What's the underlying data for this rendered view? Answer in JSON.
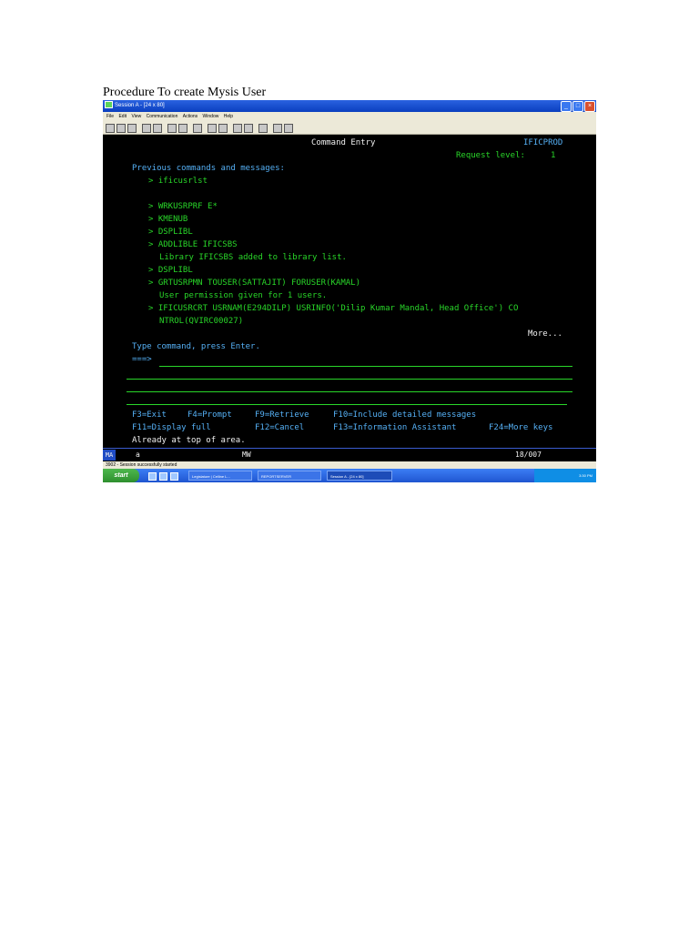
{
  "document": {
    "title": "Procedure To create Mysis User"
  },
  "window": {
    "title": "Session A - [24 x 80]",
    "menu": [
      "File",
      "Edit",
      "View",
      "Communication",
      "Actions",
      "Window",
      "Help"
    ]
  },
  "terminal": {
    "screen_title": "Command Entry",
    "system": "IFICPROD",
    "request_level_label": "Request level:",
    "request_level": "1",
    "previous_header": "Previous commands and messages:",
    "lines": [
      "> ificusrlst",
      "> WRKUSRPRF E*",
      "> KMENUB",
      "> DSPLIBL",
      "> ADDLIBLE IFICSBS",
      "Library IFICSBS added to library list.",
      "> DSPLIBL",
      "> GRTUSRPMN TOUSER(SATTAJIT) FORUSER(KAMAL)",
      "User permission given for 1 users.",
      "> IFICUSRCRT USRNAM(E294DILP) USRINFO('Dilip Kumar Mandal, Head Office') CO",
      "NTROL(QVIRC00027)"
    ],
    "more": "More...",
    "prompt": "Type command, press Enter.",
    "input_prompt": "===>",
    "fkeys_row1": [
      "F3=Exit",
      "F4=Prompt",
      "F9=Retrieve",
      "F10=Include detailed messages"
    ],
    "fkeys_row2": [
      "F11=Display full",
      "F12=Cancel",
      "F13=Information Assistant",
      "F24=More keys"
    ],
    "message": "Already at top of area."
  },
  "oia": {
    "ma": "MA",
    "session": "a",
    "mode": "MW",
    "position": "18/007"
  },
  "comm_status": "3902 - Session successfully started",
  "taskbar": {
    "start": "start",
    "tasks": [
      "Legislature | Celline L...",
      "REPORTSERVER",
      "Session A - [24 x 80]"
    ],
    "clock": "3:30 PM"
  }
}
